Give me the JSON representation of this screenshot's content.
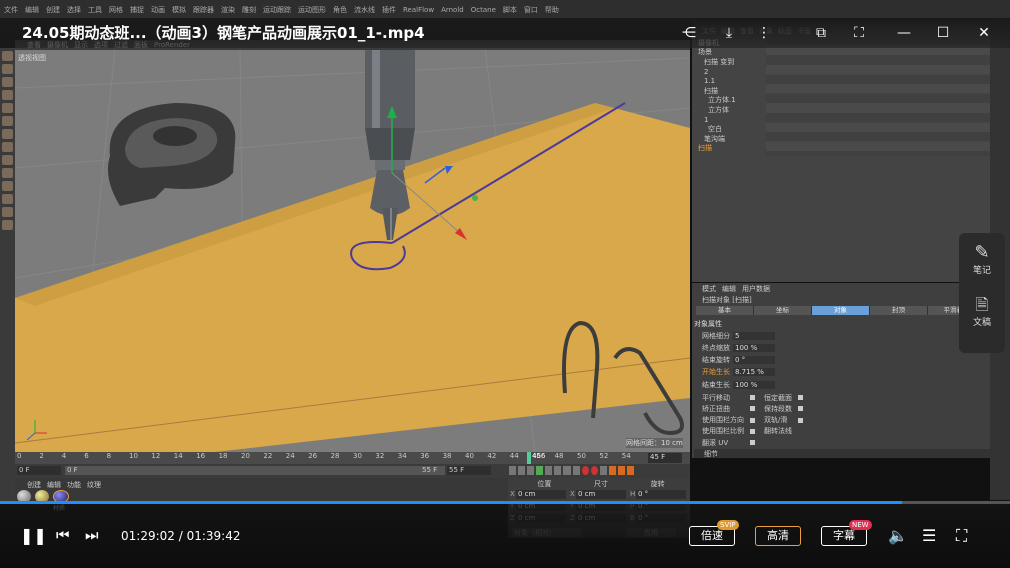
{
  "menubar": [
    "文件",
    "编辑",
    "创建",
    "选择",
    "工具",
    "网格",
    "捕捉",
    "动画",
    "模拟",
    "跟踪器",
    "渲染",
    "雕刻",
    "运动跟踪",
    "运动图形",
    "角色",
    "流水线",
    "插件",
    "RealFlow",
    "Arnold",
    "Octane",
    "脚本",
    "窗口",
    "帮助"
  ],
  "video": {
    "title": "24.05期动态班...（动画3）钢笔产品动画展示01_1-.mp4"
  },
  "viewport": {
    "menu": [
      "查看",
      "摄像机",
      "显示",
      "选项",
      "过滤",
      "面板",
      "ProRender"
    ],
    "label": "透视视图",
    "grid_info": "网格间距：10 cm"
  },
  "object_manager": {
    "menu": [
      "文件",
      "编辑",
      "查看",
      "对象",
      "标签",
      "书签"
    ],
    "items": [
      "摄像机",
      "场景",
      "扫描 变到",
      "2",
      "1.1",
      "扫描",
      "立方体.1",
      "立方体",
      "1",
      "空白",
      "笔沟端",
      "扫描"
    ]
  },
  "attributes": {
    "menu": [
      "模式",
      "编辑",
      "用户数据"
    ],
    "object_label": "扫描对象 [扫描]",
    "tabs": [
      "基本",
      "坐标",
      "对象",
      "封顶",
      "平滑着色"
    ],
    "active_tab": "对象",
    "section": "对象属性",
    "props": [
      {
        "label": "网格细分",
        "value": "5"
      },
      {
        "label": "终点缩放",
        "value": "100 %"
      },
      {
        "label": "结束旋转",
        "value": "0 °"
      },
      {
        "label": "开始生长",
        "value": "8.715 %"
      },
      {
        "label": "结束生长",
        "value": "100 %"
      }
    ],
    "checks_left": [
      "平行移动",
      "矫正扭曲",
      "使用围栏方向",
      "使用围栏比例",
      "翻滚 UV"
    ],
    "checks_right": [
      "恒定截面",
      "保持段数",
      "双轨/滑"
    ],
    "extra": "翻转法线",
    "detail": "细节"
  },
  "timeline": {
    "ticks": [
      "0",
      "2",
      "4",
      "6",
      "8",
      "10",
      "12",
      "14",
      "16",
      "18",
      "20",
      "22",
      "24",
      "26",
      "28",
      "30",
      "32",
      "34",
      "36",
      "38",
      "40",
      "42",
      "44",
      "46",
      "48",
      "50",
      "52",
      "54"
    ],
    "current": "45 F",
    "start": "0 F",
    "start2": "0 F",
    "end": "55 F",
    "end2": "55 F",
    "marker": "456"
  },
  "bottom": {
    "menu": [
      "创建",
      "编辑",
      "功能",
      "纹理"
    ],
    "material": "材质"
  },
  "coords": {
    "headers": [
      "位置",
      "尺寸",
      "旋转"
    ],
    "rows": [
      [
        "X",
        "0 cm",
        "X",
        "0 cm",
        "H",
        "0 °"
      ],
      [
        "Y",
        "0 cm",
        "Y",
        "0 cm",
        "P",
        "0 °"
      ],
      [
        "Z",
        "0 cm",
        "Z",
        "0 cm",
        "B",
        "0 °"
      ]
    ],
    "mode": "对象（相对）",
    "apply": "应用"
  },
  "side_float": {
    "notes": "笔记",
    "doc": "文稿"
  },
  "player": {
    "time": "01:29:02 / 01:39:42",
    "progress": 0.893,
    "speed": "倍速",
    "speed_badge": "SVIP",
    "quality": "高清",
    "subtitle": "字幕",
    "subtitle_badge": "NEW"
  },
  "colors": {
    "accent": "#1f8fff",
    "paper": "#d8a84a",
    "active_tab": "#6aa0d8"
  }
}
